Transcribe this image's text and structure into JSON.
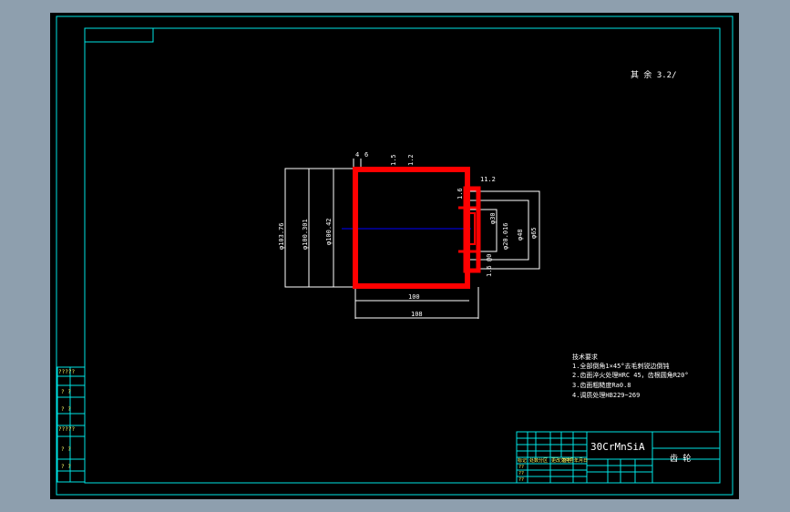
{
  "colors": {
    "frame": "#00e5e5",
    "outline": "#ffffff",
    "part": "#ff0000",
    "center_line": "#0000ff",
    "viewport_bg": "#000000",
    "window_bg": "#8e9fae"
  },
  "drawing": {
    "roughness_note": "其 余 3.2/",
    "dims": {
      "dia_outer": "φ103.76",
      "dia_mid": "φ100.301",
      "dia_inner": "φ100.42",
      "top_a": "4",
      "top_b": "6",
      "top_c": "1.5",
      "top_d": "1.2",
      "right_top": "11.2",
      "right_small": "1.6",
      "dia_sm1": "φ30",
      "dia_sm2": "φ20.016",
      "dia_48": "φ48",
      "dia_65": "φ65",
      "bottom_small": "1.6 @0",
      "len_100": "100",
      "len_108": "108"
    },
    "tech_req": {
      "title": "技术要求",
      "items": [
        "1.全部倒角1×45°去毛刺锐边倒钝",
        "2.齿面淬火处理HRC 45，齿根圆角R20°",
        "3.齿面粗糙度Ra0.8",
        "4.调质处理HB229~269"
      ]
    }
  },
  "title_block": {
    "material": "30CrMnSiA",
    "part_name": "齿 轮",
    "cells_row1": [
      "",
      "",
      "",
      ""
    ],
    "cells_small": [
      "标记",
      "处数",
      "分区",
      "更改文件号",
      "签名",
      "年月日"
    ],
    "left_labels": [
      "??",
      "??",
      "??"
    ]
  },
  "left_strip": [
    "?????",
    "? ?",
    "? ?",
    "?????",
    "? ?",
    "? ?"
  ]
}
